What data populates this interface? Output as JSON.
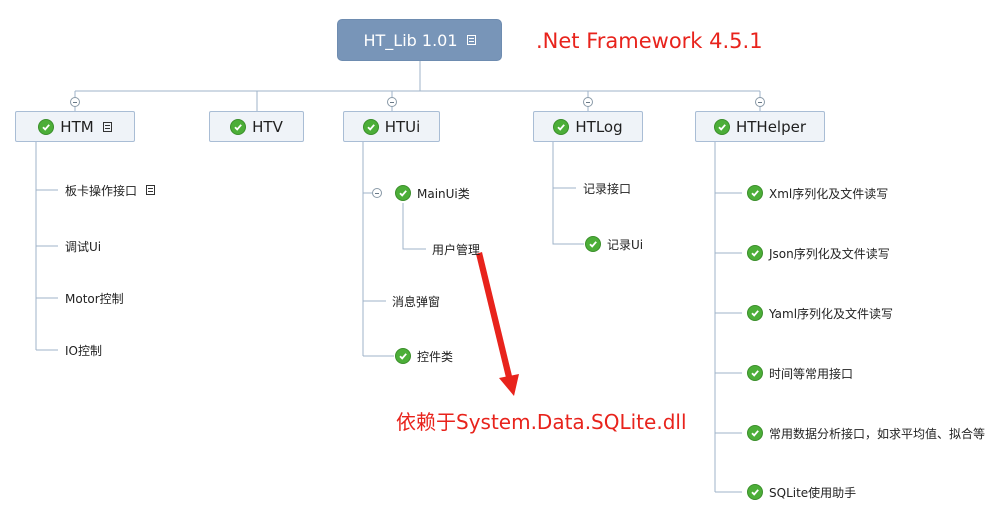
{
  "root": {
    "label": "HT_Lib 1.01",
    "icon": "note-icon"
  },
  "framework_note": ".Net Framework 4.5.1",
  "dependency_note": "依赖于System.Data.SQLite.dll",
  "colors": {
    "root_fill": "#7895b8",
    "branch_fill": "#eff3f8",
    "check": "#4cae38",
    "annotation": "#e8231c",
    "line": "#9fb3c8"
  },
  "branches": {
    "htm": {
      "label": "HTM",
      "children": {
        "board": "板卡操作接口",
        "debug": "调试Ui",
        "motor": "Motor控制",
        "io": "IO控制"
      }
    },
    "htv": {
      "label": "HTV"
    },
    "htui": {
      "label": "HTUi",
      "children": {
        "mainui": "MainUi类",
        "user_mgmt": "用户管理",
        "popup": "消息弹窗",
        "controls": "控件类"
      }
    },
    "htlog": {
      "label": "HTLog",
      "children": {
        "record_if": "记录接口",
        "record_ui": "记录Ui"
      }
    },
    "hthelper": {
      "label": "HTHelper",
      "children": {
        "xml": "Xml序列化及文件读写",
        "json": "Json序列化及文件读写",
        "yaml": "Yaml序列化及文件读写",
        "time": "时间等常用接口",
        "analysis": "常用数据分析接口，如求平均值、拟合等",
        "sqlite": "SQLite使用助手"
      }
    }
  }
}
